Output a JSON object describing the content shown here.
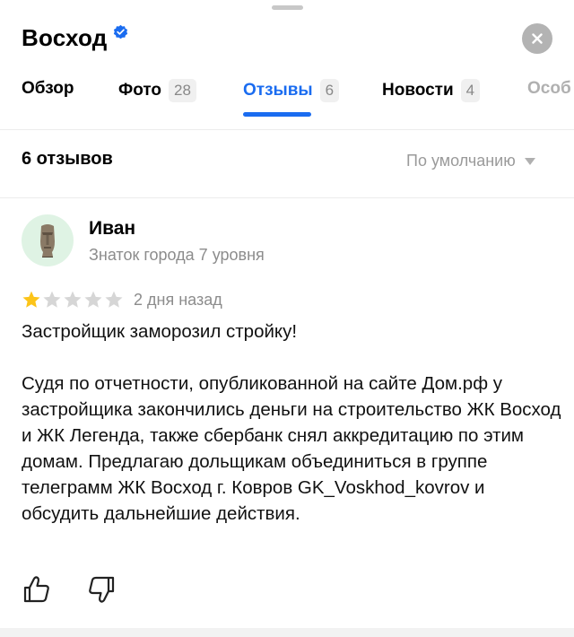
{
  "place": {
    "title": "Восход",
    "verified": true
  },
  "tabs": [
    {
      "label": "Обзор",
      "count": ""
    },
    {
      "label": "Фото",
      "count": "28"
    },
    {
      "label": "Отзывы",
      "count": "6",
      "active": true
    },
    {
      "label": "Новости",
      "count": "4"
    },
    {
      "label": "Особ",
      "count": ""
    }
  ],
  "reviews": {
    "count_label": "6 отзывов",
    "sort_label": "По умолчанию"
  },
  "review": {
    "author": "Иван",
    "level": "Знаток города 7 уровня",
    "rating": 1,
    "rating_max": 5,
    "date": "2 дня назад",
    "text": "Застройщик заморозил стройку!\n\nСудя  по отчетности, опубликованной на сайте Дом.рф у застройщика закончились деньги на строительство ЖК Восход и ЖК Легенда, также сбербанк снял аккредитацию по этим домам. Предлагаю дольщикам объединиться в группе телеграмм ЖК Восход г. Ковров  GK_Voskhod_kovrov и обсудить дальнейшие действия."
  },
  "colors": {
    "accent": "#1a6cf0",
    "star_filled": "#fcc419",
    "star_empty": "#d6d6d6",
    "avatar_bg": "#dff3e4"
  },
  "icons": [
    "verified-badge-icon",
    "close-icon",
    "moai-avatar-icon",
    "star-icon",
    "thumbs-up-icon",
    "thumbs-down-icon",
    "chevron-down-icon"
  ]
}
